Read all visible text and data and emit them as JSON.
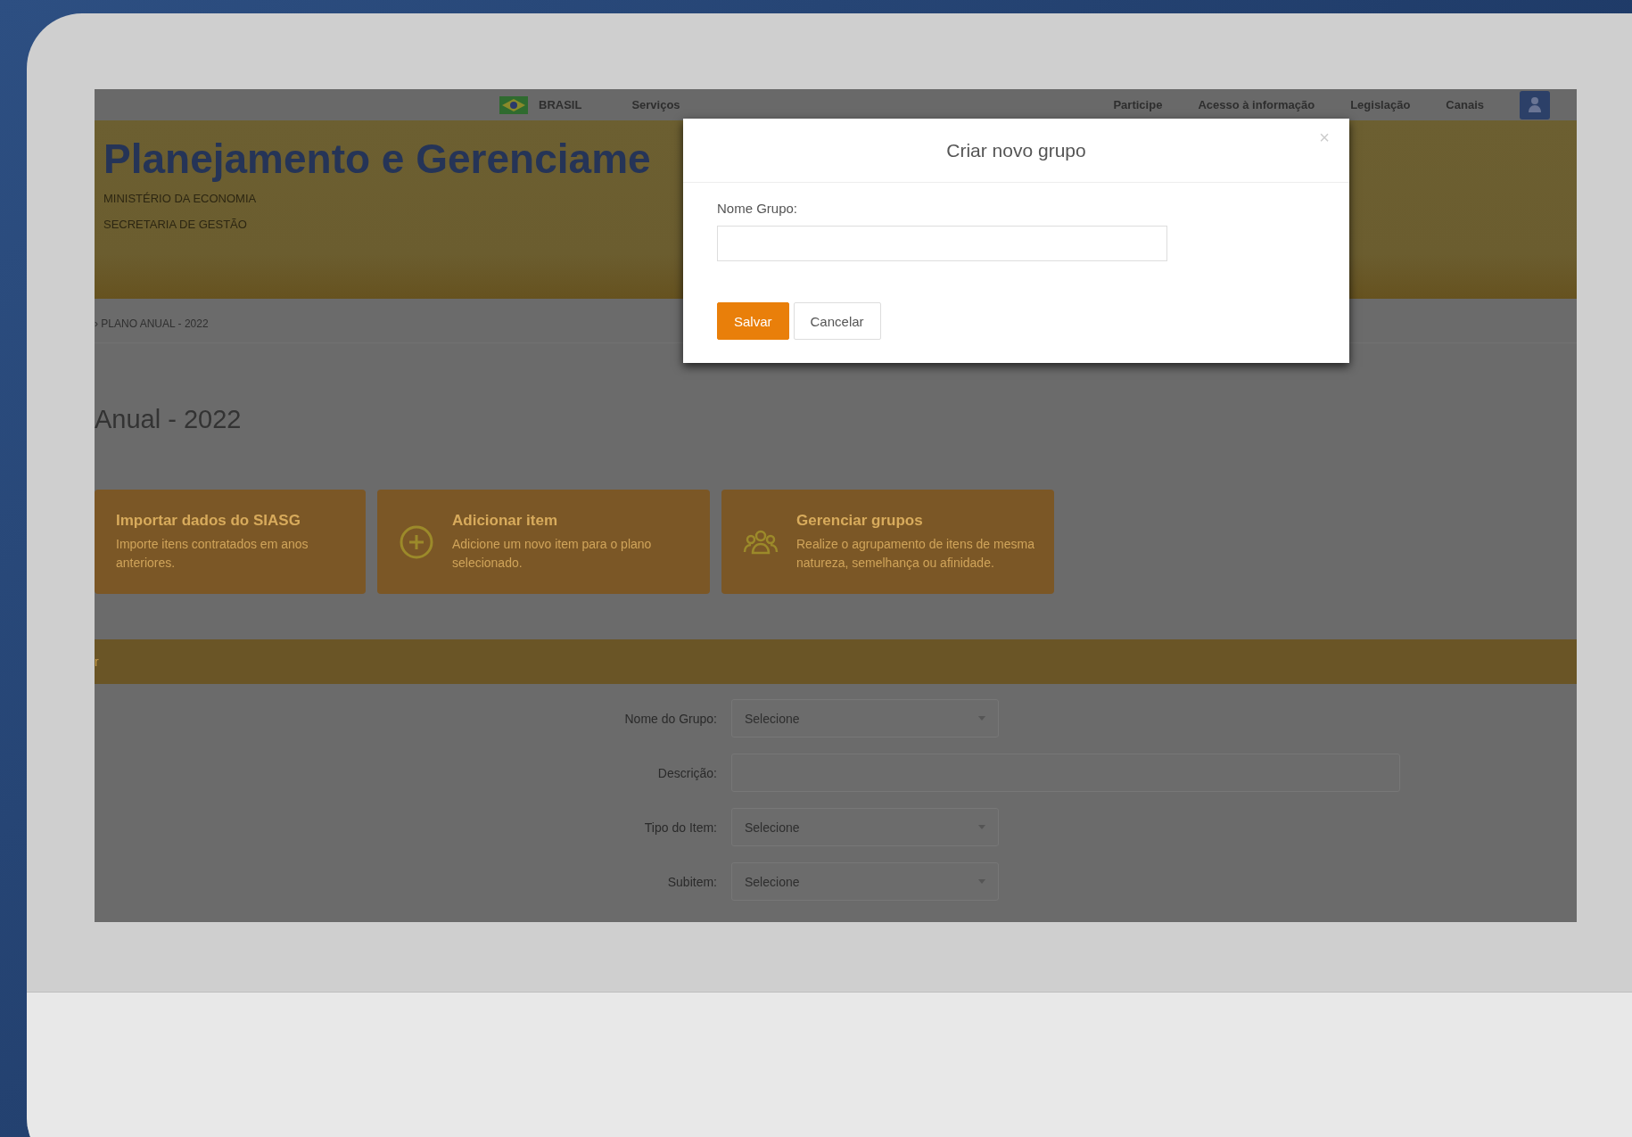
{
  "top_bar": {
    "country": "BRASIL",
    "links_left": [
      "Serviços"
    ],
    "links_right": [
      "Participe",
      "Acesso à informação",
      "Legislação",
      "Canais"
    ]
  },
  "header": {
    "title": "Planejamento e Gerenciame",
    "subtitles": [
      "MINISTÉRIO DA ECONOMIA",
      "SECRETARIA DE GESTÃO"
    ]
  },
  "breadcrumb": "› PLANO ANUAL - 2022",
  "page_title": "Anual - 2022",
  "cards": [
    {
      "kind": "plain",
      "title": "Importar dados do SIASG",
      "text": "Importe itens contratados em anos anteriores."
    },
    {
      "kind": "add",
      "title": "Adicionar item",
      "text": "Adicione um novo item para o plano selecionado."
    },
    {
      "kind": "group",
      "title": "Gerenciar grupos",
      "text": "Realize o agrupamento de itens de mesma natureza, semelhança ou afinidade."
    }
  ],
  "section_bar": {
    "label": "r"
  },
  "form": {
    "fields": [
      {
        "label": "Nome do Grupo:",
        "kind": "select",
        "value": "Selecione"
      },
      {
        "label": "Descrição:",
        "kind": "text"
      },
      {
        "label": "Tipo do Item:",
        "kind": "select",
        "value": "Selecione"
      },
      {
        "label": "Subitem:",
        "kind": "select",
        "value": "Selecione"
      }
    ]
  },
  "modal": {
    "title": "Criar novo grupo",
    "close": "×",
    "field_label": "Nome Grupo:",
    "buttons": [
      {
        "label": "Salvar",
        "kind": "primary"
      },
      {
        "label": "Cancelar",
        "kind": "secondary"
      }
    ]
  }
}
